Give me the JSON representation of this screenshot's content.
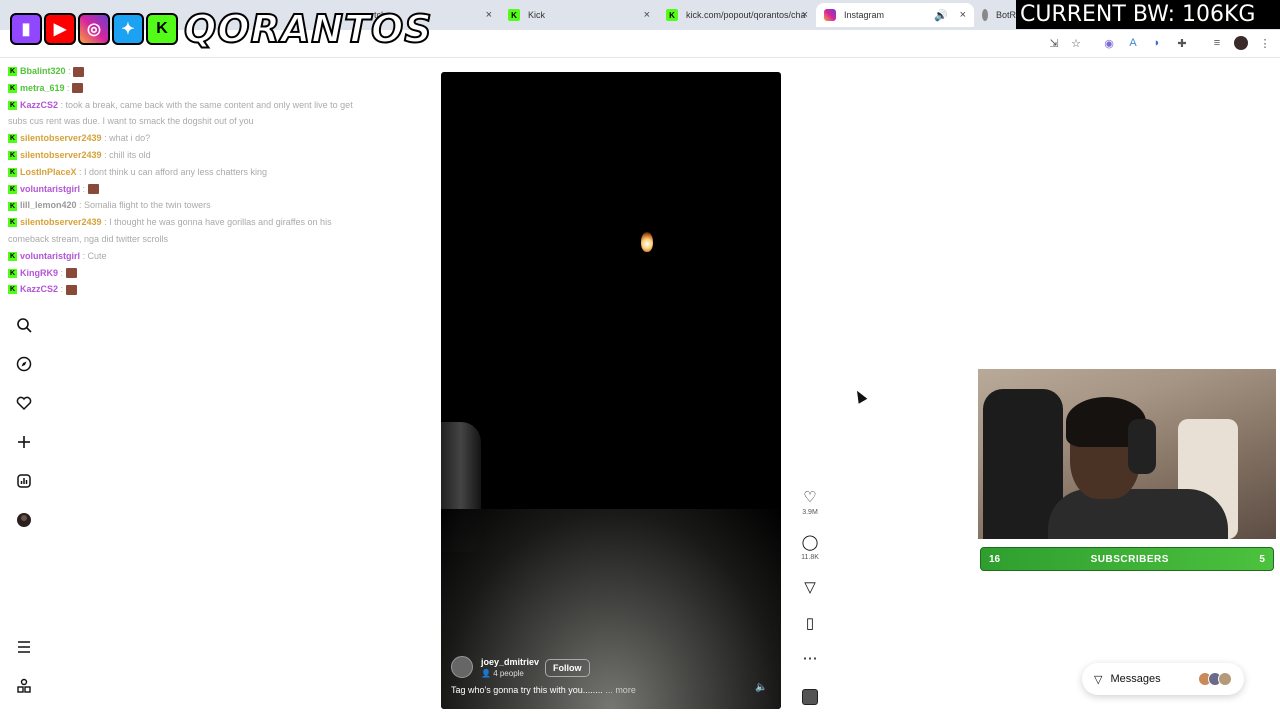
{
  "overlay": {
    "channel_name": "QORANTOS",
    "bw_banner": "CURRENT BW: 106KG"
  },
  "browser": {
    "tabs": [
      {
        "label": "tch",
        "active": false
      },
      {
        "label": "Kick",
        "active": false
      },
      {
        "label": "kick.com/popout/qorantos/cha",
        "active": false
      },
      {
        "label": "Instagram",
        "active": true
      },
      {
        "label": "BotR",
        "active": false
      }
    ]
  },
  "chat": {
    "messages": [
      {
        "user": "Bbalint320",
        "text": "",
        "user_color": "#52c43a"
      },
      {
        "user": "metra_619",
        "text": "",
        "user_color": "#52c43a"
      },
      {
        "user": "KazzCS2",
        "text": "took a break, came back with the same content and only went live to get subs cus rent was due. I want to smack the dogshit out of you",
        "user_color": "#b455d6"
      },
      {
        "user": "silentobserver2439",
        "text": "what i do?",
        "user_color": "#d6a23a"
      },
      {
        "user": "silentobserver2439",
        "text": "chill its old",
        "user_color": "#d6a23a"
      },
      {
        "user": "LostInPlaceX",
        "text": "I dont think u can afford any less chatters king",
        "user_color": "#d6a23a"
      },
      {
        "user": "voluntaristgirl",
        "text": "",
        "user_color": "#b455d6"
      },
      {
        "user": "lill_lemon420",
        "text": "Somalia flight to the twin towers",
        "user_color": "#9a9a9a"
      },
      {
        "user": "silentobserver2439",
        "text": "I thought he was gonna have gorillas and giraffes on his comeback stream, nga did twitter scrolls",
        "user_color": "#d6a23a"
      },
      {
        "user": "voluntaristgirl",
        "text": "Cute",
        "user_color": "#b455d6"
      },
      {
        "user": "KingRK9",
        "text": "",
        "user_color": "#b455d6"
      },
      {
        "user": "KazzCS2",
        "text": "",
        "user_color": "#b455d6"
      }
    ]
  },
  "reel": {
    "author": "joey_dmitriev",
    "people": "4 people",
    "follow_label": "Follow",
    "caption": "Tag who's gonna try this with you........",
    "more_label": "... more",
    "likes": "3.9M",
    "comments": "11.8K"
  },
  "stream": {
    "subs_left": "16",
    "subs_label": "SUBSCRIBERS",
    "subs_right": "5"
  },
  "messages_button": {
    "label": "Messages"
  }
}
